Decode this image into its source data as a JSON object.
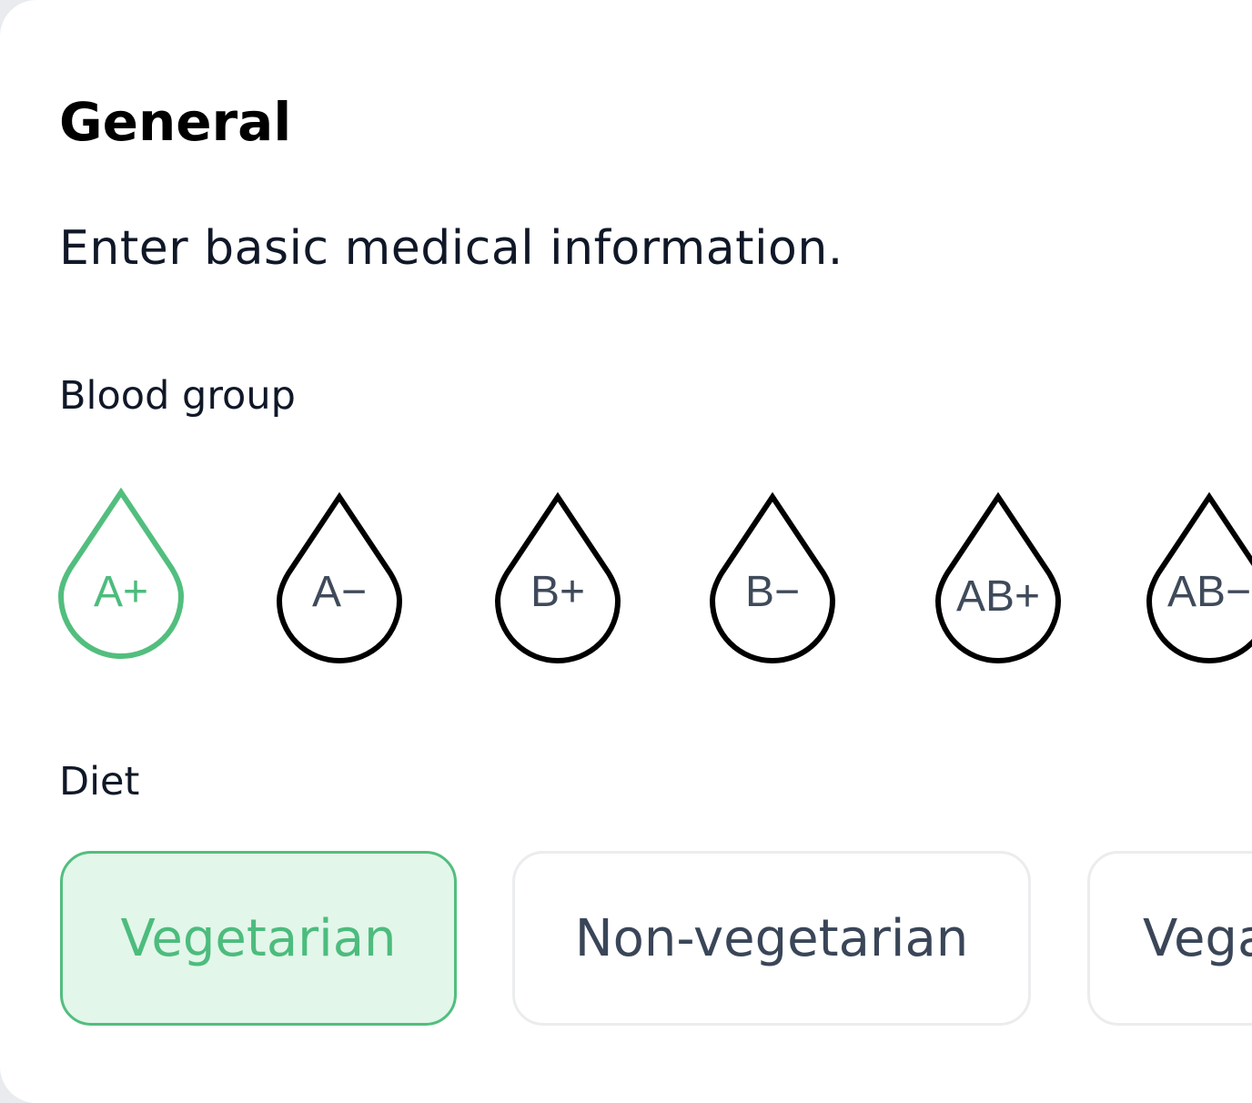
{
  "header": {
    "title": "General",
    "subtitle": "Enter basic medical information."
  },
  "blood_group": {
    "label": "Blood group",
    "selected": "A+",
    "options": [
      {
        "label": "A+",
        "selected": true
      },
      {
        "label": "A−",
        "selected": false
      },
      {
        "label": "B+",
        "selected": false
      },
      {
        "label": "B−",
        "selected": false
      },
      {
        "label": "AB+",
        "selected": false
      },
      {
        "label": "AB−",
        "selected": false
      }
    ]
  },
  "diet": {
    "label": "Diet",
    "selected": "Vegetarian",
    "options": [
      {
        "label": "Vegetarian",
        "selected": true
      },
      {
        "label": "Non-vegetarian",
        "selected": false
      },
      {
        "label": "Vega",
        "selected": false
      }
    ]
  },
  "colors": {
    "accent": "#52be7e",
    "accent_bg": "#e3f6ea",
    "text_dark": "#101828",
    "text_muted": "#3f4a5a",
    "border": "#ebecee"
  },
  "icons": {
    "blood_drop": "drop-icon"
  }
}
